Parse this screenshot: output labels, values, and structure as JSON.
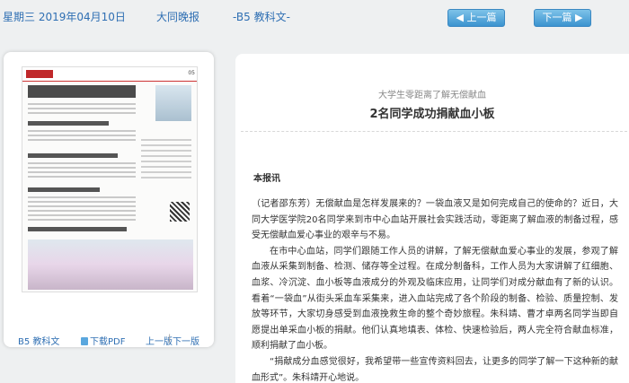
{
  "header": {
    "date": "星期三 2019年04月10日",
    "paper": "大同晚报",
    "section": "-B5 教科文-",
    "prev_button": "上一篇",
    "next_button": "下一篇"
  },
  "left_panel": {
    "thumbnail_page": "05",
    "section_link": "B5 教科文",
    "pdf_link": "下载PDF",
    "prev_page_link": "上一版",
    "separator": "|",
    "next_page_link": "下一版"
  },
  "article": {
    "subtitle": "大学生零距离了解无偿献血",
    "title": "2名同学成功捐献血小板",
    "source": "本报讯",
    "paragraphs": [
      "（记者邵东芳）无偿献血是怎样发展来的？一袋血液又是如何完成自己的使命的？近日，大同大学医学院20名同学来到市中心血站开展社会实践活动，零距离了解血液的制备过程，感受无偿献血爱心事业的艰辛与不易。",
      "在市中心血站，同学们跟随工作人员的讲解，了解无偿献血爱心事业的发展，参观了解血液从采集到制备、检测、储存等全过程。在成分制备科，工作人员为大家讲解了红细胞、血浆、冷沉淀、血小板等血液成分的外观及临床应用，让同学们对成分献血有了新的认识。看着“一袋血”从街头采血车采集来，进入血站完成了各个阶段的制备、检验、质量控制、发放等环节，大家切身感受到血液挽救生命的整个奇妙旅程。朱科靖、曹才卓两名同学当即自愿提出单采血小板的捐献。他们认真地填表、体检、快速检验后，两人完全符合献血标准，顺利捐献了血小板。",
      "“捐献成分血感觉很好，我希望带一些宣传资料回去，让更多的同学了解一下这种新的献血形式”。朱科靖开心地说。"
    ]
  },
  "colors": {
    "link_blue": "#2f6fb3",
    "button_blue": "#3b93cf",
    "background": "#eef0f1"
  }
}
